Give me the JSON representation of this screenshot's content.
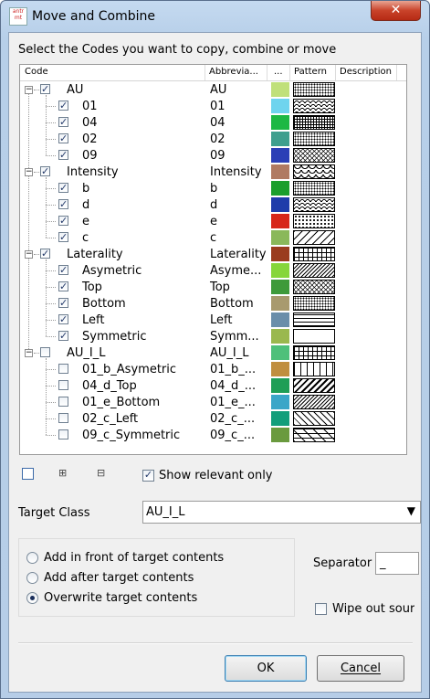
{
  "window": {
    "title": "Move and Combine",
    "close_glyph": "✕",
    "app_icon_text": "antr mt"
  },
  "instruction": "Select the Codes you want to copy, combine or move",
  "tree": {
    "columns": [
      "Code",
      "Abbrevia...",
      "...",
      "Pattern",
      "Description"
    ],
    "rows": [
      {
        "level": 0,
        "expander": "−",
        "checked": true,
        "code": "AU",
        "abbr": "AU",
        "color": "#c0e07a",
        "pattern": "dots-dense"
      },
      {
        "level": 1,
        "checked": true,
        "code": "01",
        "abbr": "01",
        "color": "#6fd4ee",
        "pattern": "waves"
      },
      {
        "level": 1,
        "checked": true,
        "code": "04",
        "abbr": "04",
        "color": "#1db844",
        "pattern": "grid-dots"
      },
      {
        "level": 1,
        "checked": true,
        "code": "02",
        "abbr": "02",
        "color": "#3e9f8e",
        "pattern": "dots-dense"
      },
      {
        "level": 1,
        "checked": true,
        "code": "09",
        "abbr": "09",
        "color": "#2b3fb6",
        "pattern": "zigzag"
      },
      {
        "level": 0,
        "expander": "−",
        "checked": true,
        "code": "Intensity",
        "abbr": "Intensity",
        "color": "#b07a62",
        "pattern": "scallop"
      },
      {
        "level": 1,
        "checked": true,
        "code": "b",
        "abbr": "b",
        "color": "#1a9e2c",
        "pattern": "dots-dense"
      },
      {
        "level": 1,
        "checked": true,
        "code": "d",
        "abbr": "d",
        "color": "#1e3caa",
        "pattern": "waves"
      },
      {
        "level": 1,
        "checked": true,
        "code": "e",
        "abbr": "e",
        "color": "#d7261a",
        "pattern": "dots"
      },
      {
        "level": 1,
        "checked": true,
        "code": "c",
        "abbr": "c",
        "color": "#8ab85a",
        "pattern": "diag"
      },
      {
        "level": 0,
        "expander": "−",
        "checked": true,
        "code": "Laterality",
        "abbr": "Laterality",
        "color": "#9a3c1e",
        "pattern": "grid"
      },
      {
        "level": 1,
        "checked": true,
        "code": "Asymetric",
        "abbr": "Asyme...",
        "color": "#86d63a",
        "pattern": "diag-dense"
      },
      {
        "level": 1,
        "checked": true,
        "code": "Top",
        "abbr": "Top",
        "color": "#3e9a3a",
        "pattern": "zigzag"
      },
      {
        "level": 1,
        "checked": true,
        "code": "Bottom",
        "abbr": "Bottom",
        "color": "#a89a6e",
        "pattern": "dots-dense"
      },
      {
        "level": 1,
        "checked": true,
        "code": "Left",
        "abbr": "Left",
        "color": "#6a8eaa",
        "pattern": "hlines"
      },
      {
        "level": 1,
        "checked": true,
        "code": "Symmetric",
        "abbr": "Symm...",
        "color": "#9ab84e",
        "pattern": "blank"
      },
      {
        "level": 0,
        "expander": "−",
        "checked": false,
        "code": "AU_I_L",
        "abbr": "AU_I_L",
        "color": "#4ec07a",
        "pattern": "grid"
      },
      {
        "level": 1,
        "checked": false,
        "code": "01_b_Asymetric",
        "abbr": "01_b_...",
        "color": "#c08e3e",
        "pattern": "vlines"
      },
      {
        "level": 1,
        "checked": false,
        "code": "04_d_Top",
        "abbr": "04_d_...",
        "color": "#1e9e56",
        "pattern": "diag-thick"
      },
      {
        "level": 1,
        "checked": false,
        "code": "01_e_Bottom",
        "abbr": "01_e_...",
        "color": "#3aa6c8",
        "pattern": "diag-dense"
      },
      {
        "level": 1,
        "checked": false,
        "code": "02_c_Left",
        "abbr": "02_c_...",
        "color": "#129e7a",
        "pattern": "diag-back"
      },
      {
        "level": 1,
        "checked": false,
        "code": "09_c_Symmetric",
        "abbr": "09_c_...",
        "color": "#6a9a3e",
        "pattern": "brick"
      }
    ]
  },
  "toolbar": {
    "show_relevant_label": "Show relevant only",
    "show_relevant_checked": true
  },
  "target_class": {
    "label": "Target Class",
    "value": "AU_I_L"
  },
  "placement": {
    "options": [
      "Add in front of target contents",
      "Add after target contents",
      "Overwrite target contents"
    ],
    "selected": 2
  },
  "separator": {
    "label": "Separator",
    "value": "_"
  },
  "wipe_out": {
    "label": "Wipe out source",
    "checked": false
  },
  "buttons": {
    "ok": "OK",
    "cancel": "Cancel"
  }
}
